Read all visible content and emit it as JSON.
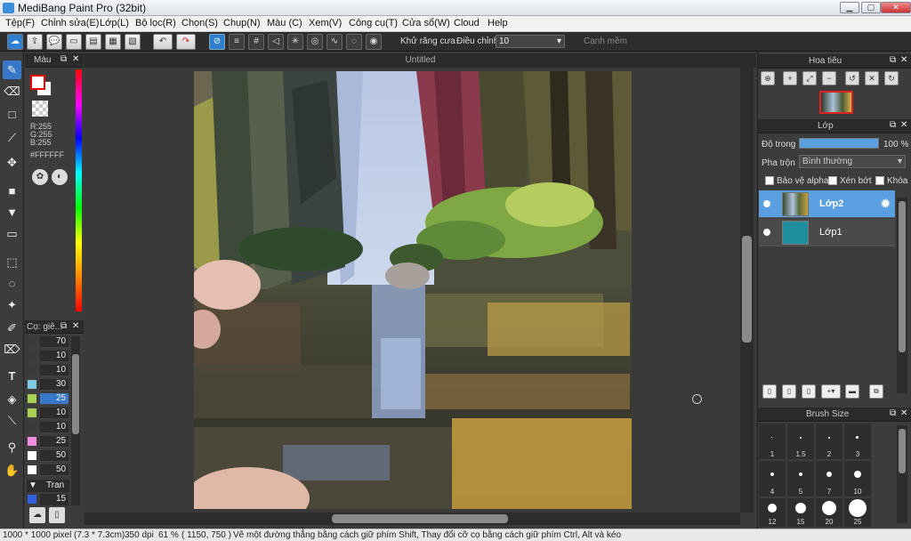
{
  "window": {
    "title": "MediBang Paint Pro (32bit)",
    "minimize": "▁",
    "maximize": "▢",
    "close": "✕"
  },
  "menu": [
    {
      "label": "Tệp(F)"
    },
    {
      "label": "Chỉnh sửa(E)"
    },
    {
      "label": "Lớp(L)"
    },
    {
      "label": "Bộ lọc(R)"
    },
    {
      "label": "Chọn(S)"
    },
    {
      "label": "Chụp(N)"
    },
    {
      "label": "Màu (C)"
    },
    {
      "label": "Xem(V)"
    },
    {
      "label": "Công cụ(T)"
    },
    {
      "label": "Cửa sổ(W)"
    },
    {
      "label": "Cloud"
    },
    {
      "label": "Help"
    }
  ],
  "toolbar": {
    "antialias_label": "Khử răng cưa",
    "correction_label": "Điều chỉnh",
    "correction_value": "10",
    "smooth_label": "Cạnh mềm"
  },
  "color_panel": {
    "title": "Màu",
    "r": "R:255",
    "g": "G:255",
    "b": "B:255",
    "hex": "#FFFFFF",
    "fg_color": "#FFFFFF"
  },
  "brush_panel": {
    "title": "Cọ: giê...",
    "items": [
      {
        "value": "70",
        "color": "#3a3a3a"
      },
      {
        "value": "10",
        "color": "#3a3a3a"
      },
      {
        "value": "10",
        "color": "#3a3a3a"
      },
      {
        "value": "30",
        "color": "#7ec8e3"
      },
      {
        "value": "25",
        "color": "#a8d050"
      },
      {
        "value": "10",
        "color": "#a8d050"
      },
      {
        "value": "10",
        "color": "#3a3a3a"
      },
      {
        "value": "25",
        "color": "#f090e0"
      },
      {
        "value": "50",
        "color": "#ffffff"
      },
      {
        "value": "50",
        "color": "#ffffff"
      }
    ],
    "group_label": "Tran",
    "last_value": "15"
  },
  "document": {
    "tab": "Untitled"
  },
  "navigator": {
    "title": "Hoa tiêu"
  },
  "layers": {
    "title": "Lớp",
    "opacity_label": "Độ trong",
    "opacity_value": "100 %",
    "opacity": 1.0,
    "blend_label": "Pha trộn",
    "blend_value": "Bình thường",
    "protect_alpha": "Bảo vệ alpha",
    "clipping": "Xén bớt",
    "lock": "Khóa",
    "list": [
      {
        "name": "Lớp2",
        "selected": true
      },
      {
        "name": "Lớp1",
        "selected": false
      }
    ]
  },
  "brush_size": {
    "title": "Brush Size",
    "sizes": [
      "1",
      "1.5",
      "2",
      "3",
      "4",
      "5",
      "7",
      "10",
      "12",
      "15",
      "20",
      "25"
    ]
  },
  "status": {
    "size": "1000 * 1000 pixel",
    "cm": "(7.3 * 7.3cm)",
    "dpi": "350 dpi",
    "zoom": "61 %",
    "coords": "( 1150, 750 )",
    "hint": "Vẽ một đường thẳng bằng cách giữ phím Shift, Thay đổi cỡ cọ bằng cách giữ phím Ctrl, Alt và kéo"
  }
}
